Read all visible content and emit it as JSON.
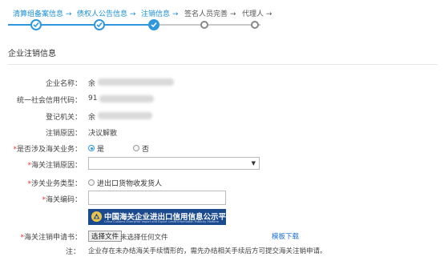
{
  "steps": [
    {
      "label": "清算组备案信息",
      "state": "done"
    },
    {
      "label": "债权人公告信息",
      "state": "done"
    },
    {
      "label": "注销信息",
      "state": "current"
    },
    {
      "label": "签名人员完善",
      "state": "todo"
    },
    {
      "label": "代理人",
      "state": "todo"
    }
  ],
  "step_arrow": "→",
  "section_title": "企业注销信息",
  "fields": {
    "company_name": {
      "label": "企业名称：",
      "value": "余"
    },
    "credit_code": {
      "label": "统一社会信用代码：",
      "value": "91"
    },
    "registration_authority": {
      "label": "登记机关：",
      "value": "余"
    },
    "cancel_reason": {
      "label": "注销原因：",
      "value": "决议解散"
    },
    "customs_involved": {
      "label": "是否涉及海关业务：",
      "options": [
        "是",
        "否"
      ],
      "selected": "是"
    },
    "customs_cancel_reason": {
      "label": "海关注销原因：",
      "value": ""
    },
    "customs_business_type": {
      "label": "涉关业务类型：",
      "option": "进出口货物收发货人"
    },
    "customs_code": {
      "label": "海关编码：",
      "value": ""
    }
  },
  "banner": {
    "title": "中国海关企业进出口信用信息公示平台",
    "subtitle": "China Customs Enterprise Import and Export Credit Information Publicity Platform"
  },
  "upload": {
    "label": "海关注销申请书：",
    "button_label": "选择文件",
    "no_file_text": "未选择任何文件",
    "template_link": "模板下载"
  },
  "note": {
    "label": "注：",
    "text": "企业存在未办结海关手续情形的，需先办结相关手续后方可提交海关注销申请。"
  },
  "required_mark": "*",
  "colors": {
    "accent": "#2e97dd",
    "required": "#e33333",
    "link": "#1a6fd6",
    "banner_bg": "#1b4a8e"
  }
}
